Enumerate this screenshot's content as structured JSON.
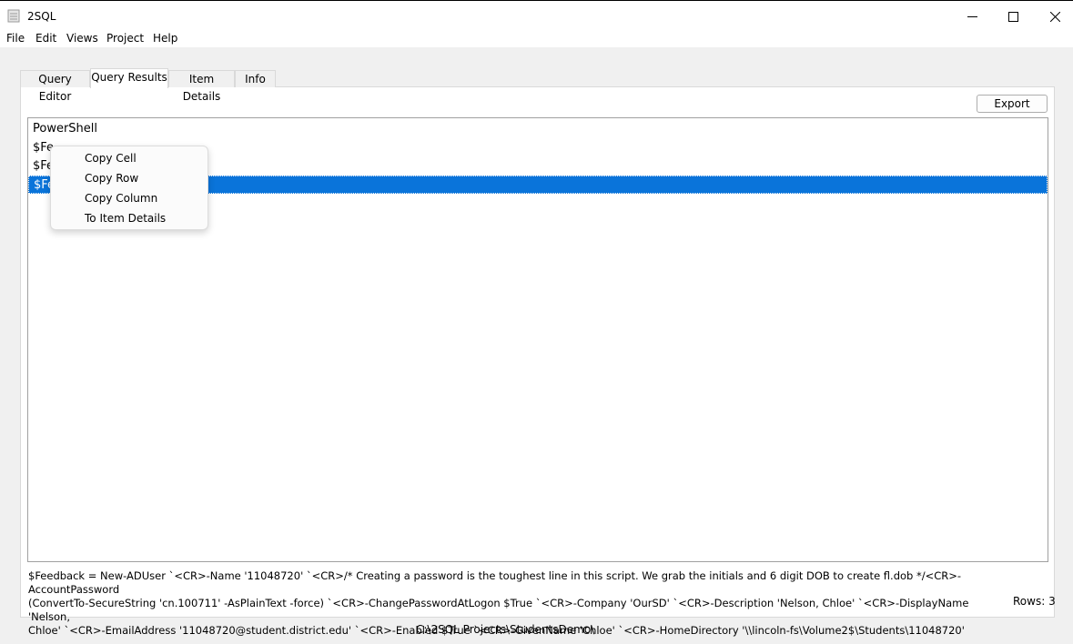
{
  "window": {
    "title": "2SQL",
    "icon": "app-icon",
    "controls": {
      "minimize": "minimize-icon",
      "maximize": "maximize-icon",
      "close": "close-icon"
    }
  },
  "menu": [
    "File",
    "Edit",
    "Views",
    "Project",
    "Help"
  ],
  "tabs": [
    {
      "label": "Query Editor",
      "active": false
    },
    {
      "label": "Query Results",
      "active": true
    },
    {
      "label": "Item Details",
      "active": false
    },
    {
      "label": "Info",
      "active": false
    }
  ],
  "toolbar": {
    "export_label": "Export"
  },
  "results": {
    "header": "PowerShell",
    "rows": [
      "$Fe",
      "$Fe",
      "$Fe"
    ],
    "selected_row": 2
  },
  "context_menu": {
    "items": [
      "Copy Cell",
      "Copy Row",
      "Copy Column",
      "To Item Details"
    ]
  },
  "detail": {
    "line1": "$Feedback = New-ADUser `<CR>-Name '11048720' `<CR>/* Creating a password is the toughest line in this script. We grab the initials and 6 digit DOB to create fl.dob  */<CR>-AccountPassword",
    "line2": "(ConvertTo-SecureString 'cn.100711' -AsPlainText -force) `<CR>-ChangePasswordAtLogon $True `<CR>-Company 'OurSD' `<CR>-Description 'Nelson, Chloe' `<CR>-DisplayName 'Nelson,",
    "line3": "Chloe' `<CR>-EmailAddress '11048720@student.district.edu' `<CR>-Enabled $True `<CR>-GivenName 'Chloe' `<CR>-HomeDirectory '\\\\lincoln-fs\\Volume2$\\Students\\11048720'"
  },
  "status": {
    "rows_label": "Rows: 3",
    "path": "C:\\2SQL Projects\\StudentsDemo\\"
  },
  "colors": {
    "selection": "#0a74da",
    "background": "#f0f0f0"
  }
}
